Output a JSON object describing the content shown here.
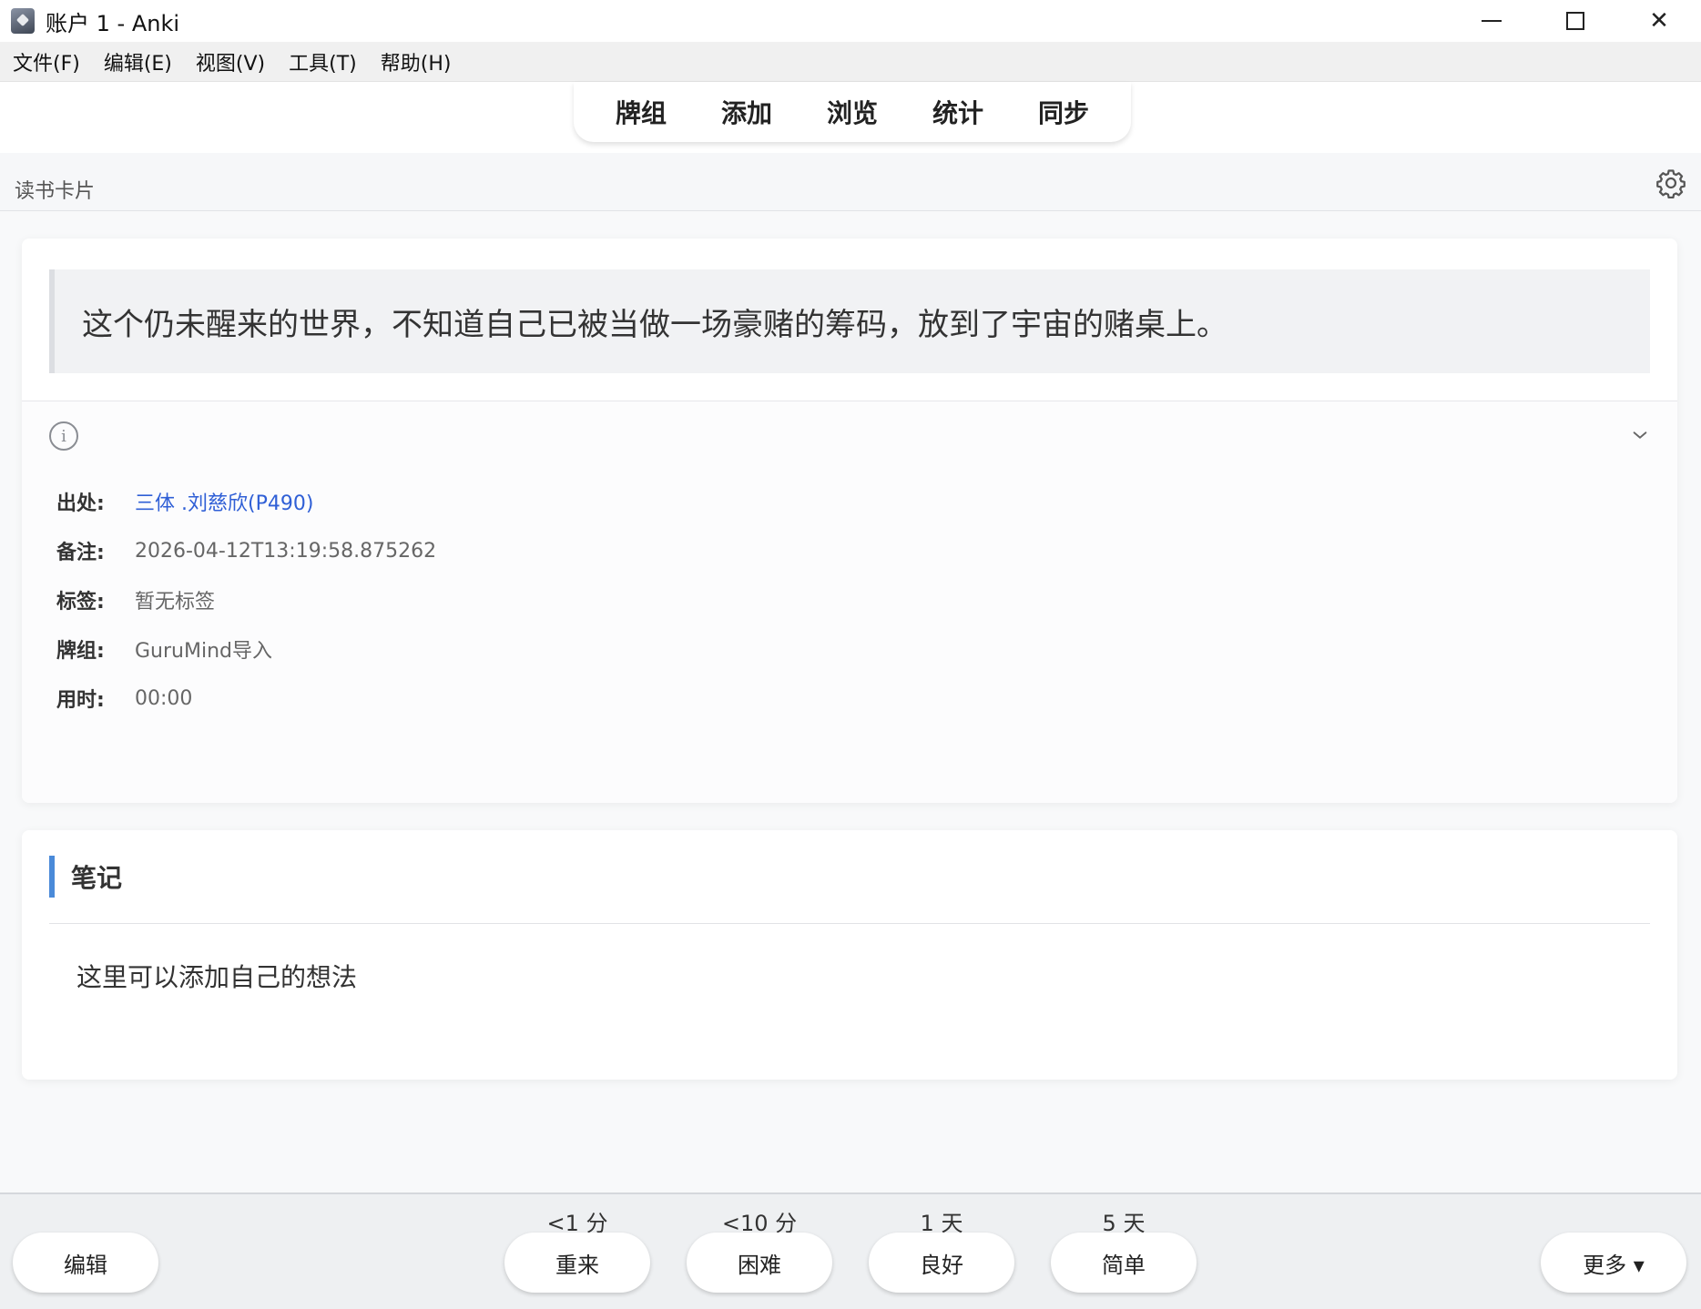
{
  "window": {
    "title": "账户 1 - Anki",
    "minimize": "—",
    "close": "✕"
  },
  "menu": [
    "文件(F)",
    "编辑(E)",
    "视图(V)",
    "工具(T)",
    "帮助(H)"
  ],
  "topnav": [
    "牌组",
    "添加",
    "浏览",
    "统计",
    "同步"
  ],
  "deck": {
    "title": "读书卡片"
  },
  "card": {
    "quote": "这个仍未醒来的世界，不知道自己已被当做一场豪赌的筹码，放到了宇宙的赌桌上。",
    "info_icon": "i",
    "meta": [
      {
        "label": "出处:",
        "value": "三体 .刘慈欣(P490)"
      },
      {
        "label": "备注:",
        "value": "2026-04-12T13:19:58.875262"
      },
      {
        "label": "标签:",
        "value": "暂无标签"
      },
      {
        "label": "牌组:",
        "value": "GuruMind导入"
      },
      {
        "label": "用时:",
        "value": "00:00"
      }
    ]
  },
  "notes": {
    "title": "笔记",
    "body": "这里可以添加自己的想法"
  },
  "bottom": {
    "edit": "编辑",
    "answers": [
      {
        "interval": "<1 分",
        "label": "重来"
      },
      {
        "interval": "<10 分",
        "label": "困难"
      },
      {
        "interval": "1 天",
        "label": "良好"
      },
      {
        "interval": "5 天",
        "label": "简单"
      }
    ],
    "more": "更多 ▾"
  },
  "colors": {
    "link": "#2f5fd6",
    "accent": "#4a8ad9"
  },
  "icons": {
    "app": "anki-app-icon",
    "settings": "gear-icon",
    "info": "info-icon",
    "expand": "chevron-down-icon"
  }
}
